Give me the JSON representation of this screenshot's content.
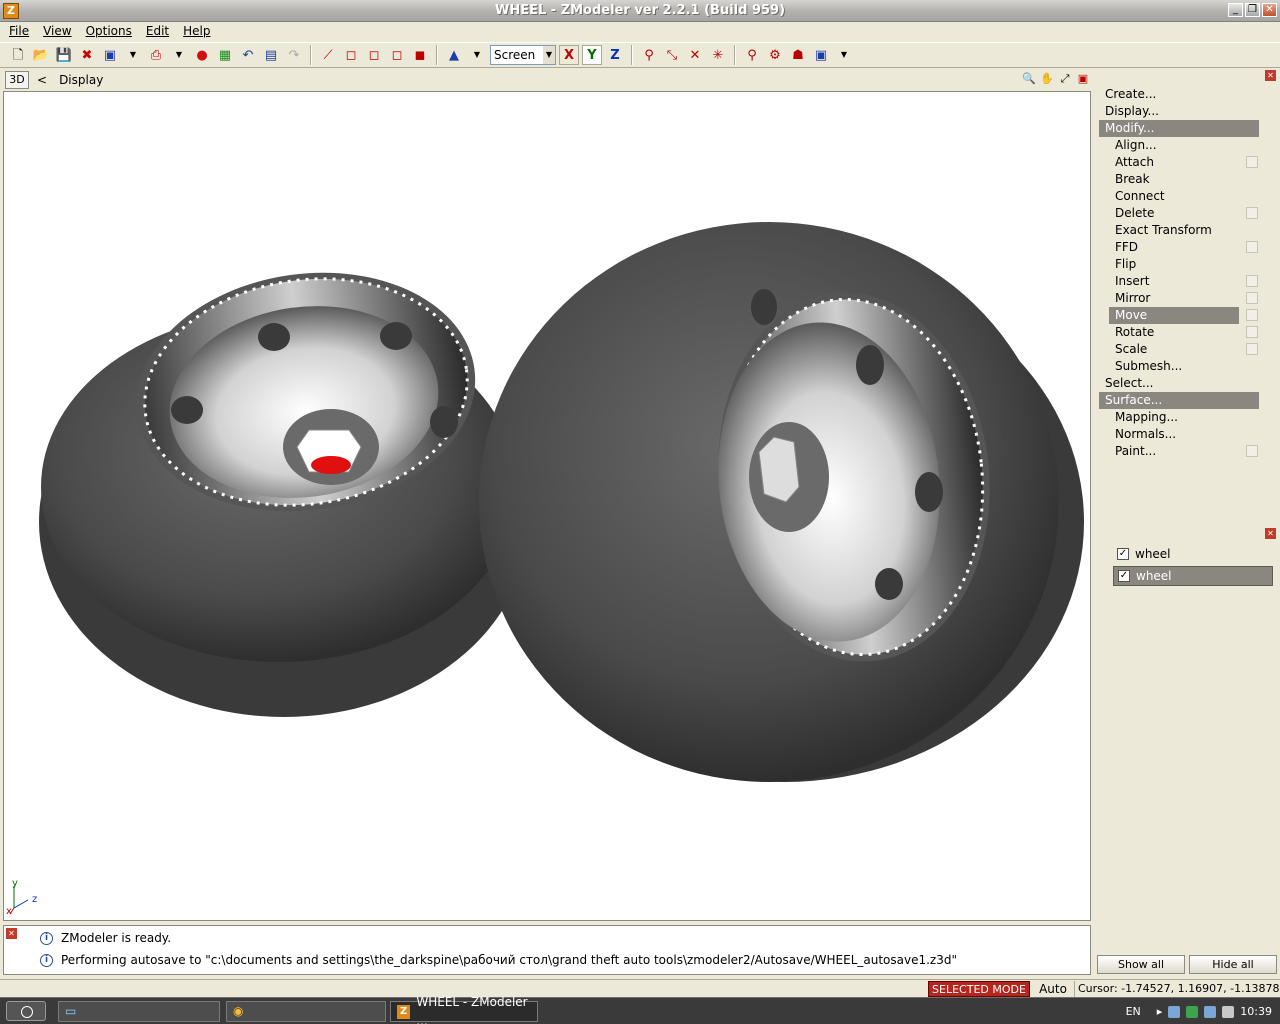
{
  "window": {
    "title": "WHEEL - ZModeler ver 2.2.1 (Build 959)",
    "icon_letter": "Z"
  },
  "menu": [
    "File",
    "View",
    "Options",
    "Edit",
    "Help"
  ],
  "toolbar": {
    "space_combo": "Screen",
    "axes": [
      "X",
      "Y",
      "Z"
    ],
    "axis_colors": {
      "X": "#c00000",
      "Y": "#007000",
      "Z": "#0030c0"
    }
  },
  "viewport": {
    "mode_button": "3D",
    "back_arrow": "<",
    "view_name": "Display"
  },
  "axes_indicator": {
    "y": "y",
    "z": "z",
    "x": "x"
  },
  "command_panel": {
    "items": [
      {
        "label": "Create...",
        "level": 0
      },
      {
        "label": "Display...",
        "level": 0
      },
      {
        "label": "Modify...",
        "level": 0,
        "header": true
      },
      {
        "label": "Align...",
        "level": 1
      },
      {
        "label": "Attach",
        "level": 1,
        "check": true
      },
      {
        "label": "Break",
        "level": 1
      },
      {
        "label": "Connect",
        "level": 1
      },
      {
        "label": "Delete",
        "level": 1,
        "check": true
      },
      {
        "label": "Exact Transform",
        "level": 1
      },
      {
        "label": "FFD",
        "level": 1,
        "check": true
      },
      {
        "label": "Flip",
        "level": 1
      },
      {
        "label": "Insert",
        "level": 1,
        "check": true
      },
      {
        "label": "Mirror",
        "level": 1,
        "check": true
      },
      {
        "label": "Move",
        "level": 1,
        "check": true,
        "active": true
      },
      {
        "label": "Rotate",
        "level": 1,
        "check": true
      },
      {
        "label": "Scale",
        "level": 1,
        "check": true
      },
      {
        "label": "Submesh...",
        "level": 1
      },
      {
        "label": "Select...",
        "level": 0
      },
      {
        "label": "Surface...",
        "level": 0,
        "header": true
      },
      {
        "label": "Mapping...",
        "level": 1
      },
      {
        "label": "Normals...",
        "level": 1
      },
      {
        "label": "Paint...",
        "level": 1,
        "check": true
      }
    ]
  },
  "objects": {
    "items": [
      {
        "label": "wheel",
        "checked": true,
        "selected": false
      },
      {
        "label": "wheel",
        "checked": true,
        "selected": true
      }
    ],
    "show_all": "Show all",
    "hide_all": "Hide all"
  },
  "log": [
    "ZModeler is ready.",
    "Performing autosave to \"c:\\documents and settings\\the_darkspine\\рабочий стол\\grand theft auto tools\\zmodeler2/Autosave/WHEEL_autosave1.z3d\""
  ],
  "status": {
    "mode": "SELECTED MODE",
    "auto": "Auto",
    "cursor": "Cursor: -1.74527, 1.16907, -1.13878"
  },
  "taskbar": {
    "active_task": "WHEEL - ZModeler ...",
    "lang": "EN",
    "clock": "10:39"
  }
}
